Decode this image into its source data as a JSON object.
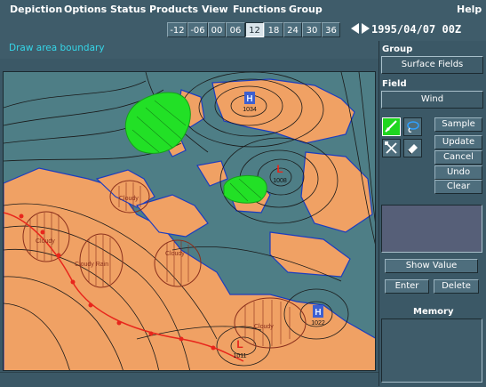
{
  "menu": {
    "items": [
      "Depiction",
      "Options",
      "Status",
      "Products",
      "View",
      "Functions",
      "Group"
    ],
    "help": "Help"
  },
  "hours": [
    "-12",
    "-06",
    "00",
    "06",
    "12",
    "18",
    "24",
    "30",
    "36"
  ],
  "selected_hour": "12",
  "datetime": "1995/04/07 00Z",
  "status_message": "Draw area boundary",
  "panel": {
    "group_label": "Group",
    "group_value": "Surface Fields",
    "field_label": "Field",
    "field_value": "Wind",
    "sample": "Sample",
    "update": "Update",
    "cancel": "Cancel",
    "undo": "Undo",
    "clear": "Clear",
    "show_value": "Show Value",
    "enter": "Enter",
    "delete": "Delete",
    "memory_label": "Memory"
  },
  "tools": [
    {
      "icon": "draw-line-icon",
      "selected": true
    },
    {
      "icon": "lasso-icon",
      "selected": false
    },
    {
      "icon": "move-icon",
      "selected": false
    },
    {
      "icon": "eraser-icon",
      "selected": false
    }
  ],
  "map": {
    "high_symbol": "H",
    "low_symbol": "L",
    "pressure_centers": [
      {
        "type": "H",
        "value": "1034"
      },
      {
        "type": "L",
        "value": "1008"
      },
      {
        "type": "H",
        "value": "1022"
      },
      {
        "type": "L",
        "value": "1011"
      }
    ],
    "area_labels": [
      "Cloudy",
      "Cloudy Rain",
      "Cloudy",
      "Cloudy",
      "Cloudy"
    ],
    "colors": {
      "water": "#4e7e86",
      "land": "#f0a164",
      "isobar": "#1a1a1a",
      "precip": "#1fdd22",
      "cloud_hatch": "#8a2f1c",
      "front": "#e8261c",
      "pressure_symbol": "#3d5fd0"
    }
  }
}
